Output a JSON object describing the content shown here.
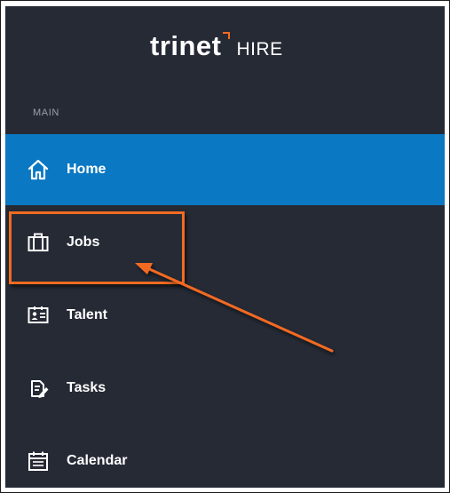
{
  "app": {
    "brand": "trinet",
    "product": "HIRE"
  },
  "sidebar": {
    "section_label": "MAIN",
    "items": [
      {
        "label": "Home",
        "icon": "home-icon",
        "active": true
      },
      {
        "label": "Jobs",
        "icon": "briefcase-icon",
        "active": false
      },
      {
        "label": "Talent",
        "icon": "id-card-icon",
        "active": false
      },
      {
        "label": "Tasks",
        "icon": "clipboard-edit-icon",
        "active": false
      },
      {
        "label": "Calendar",
        "icon": "calendar-icon",
        "active": false
      }
    ]
  },
  "colors": {
    "sidebar_bg": "#252a35",
    "active_bg": "#0a78c2",
    "accent": "#f26b21",
    "text": "#ffffff",
    "muted_text": "#9aa0aa"
  }
}
